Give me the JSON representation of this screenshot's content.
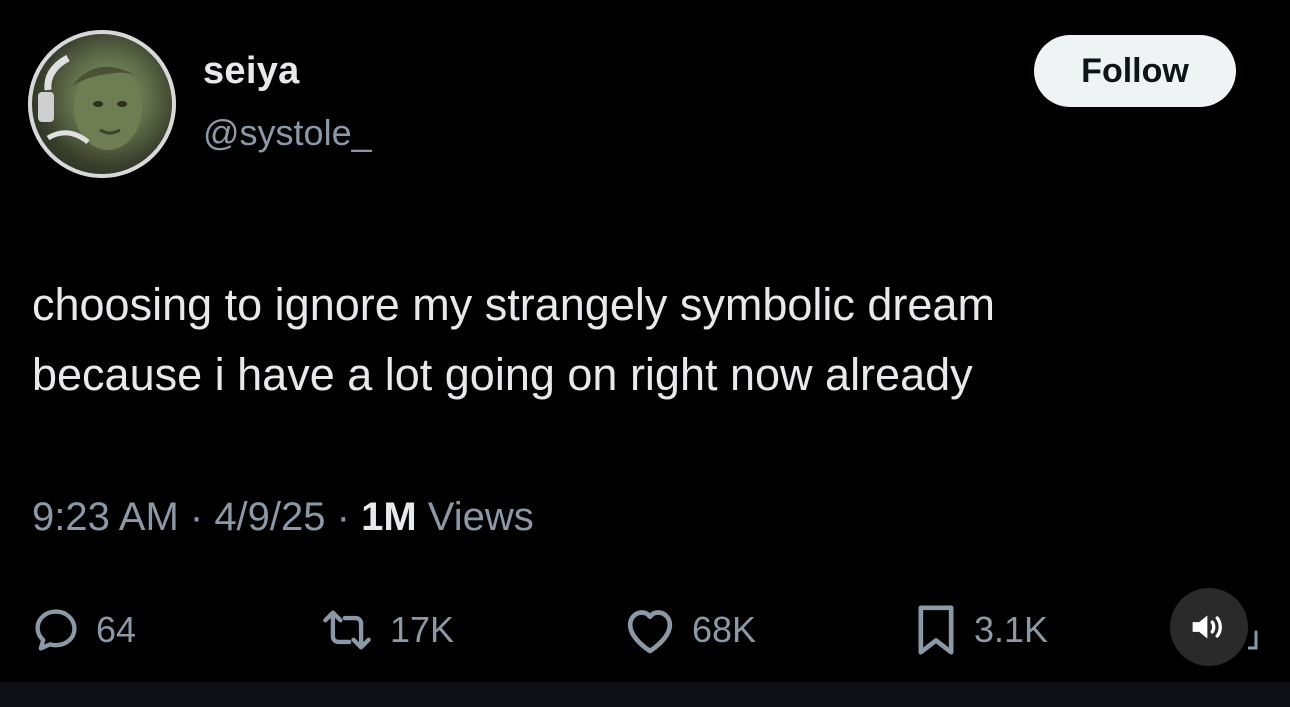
{
  "post": {
    "author": {
      "display_name": "seiya",
      "handle": "@systole_"
    },
    "follow_label": "Follow",
    "text_lines": [
      "choosing to ignore my strangely symbolic dream",
      "because i have a lot going on right now already"
    ],
    "meta": {
      "time": "9:23 AM",
      "sep1": " · ",
      "date": "4/9/25",
      "sep2": " · ",
      "views_count": "1M",
      "views_label": " Views"
    },
    "actions": {
      "replies": "64",
      "reposts": "17K",
      "likes": "68K",
      "bookmarks": "3.1K"
    }
  },
  "icons": {
    "reply": "speech-bubble-icon",
    "repost": "repost-arrows-icon",
    "like": "heart-icon",
    "bookmark": "bookmark-icon",
    "sound": "speaker-icon",
    "share": "share-icon"
  },
  "colors": {
    "background": "#000000",
    "text_primary": "#e7e9ea",
    "text_secondary": "#8b98a5",
    "follow_bg": "#eff3f4",
    "follow_text": "#0f1419",
    "mute_bg": "#2a2a2a"
  }
}
